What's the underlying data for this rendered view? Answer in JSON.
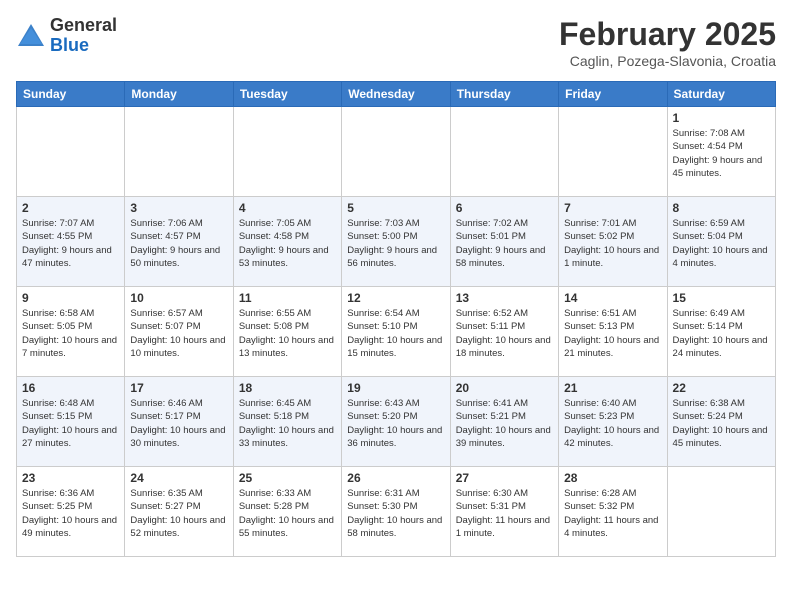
{
  "header": {
    "logo_general": "General",
    "logo_blue": "Blue",
    "title": "February 2025",
    "subtitle": "Caglin, Pozega-Slavonia, Croatia"
  },
  "days_of_week": [
    "Sunday",
    "Monday",
    "Tuesday",
    "Wednesday",
    "Thursday",
    "Friday",
    "Saturday"
  ],
  "weeks": [
    [
      {
        "day": "",
        "info": ""
      },
      {
        "day": "",
        "info": ""
      },
      {
        "day": "",
        "info": ""
      },
      {
        "day": "",
        "info": ""
      },
      {
        "day": "",
        "info": ""
      },
      {
        "day": "",
        "info": ""
      },
      {
        "day": "1",
        "info": "Sunrise: 7:08 AM\nSunset: 4:54 PM\nDaylight: 9 hours and 45 minutes."
      }
    ],
    [
      {
        "day": "2",
        "info": "Sunrise: 7:07 AM\nSunset: 4:55 PM\nDaylight: 9 hours and 47 minutes."
      },
      {
        "day": "3",
        "info": "Sunrise: 7:06 AM\nSunset: 4:57 PM\nDaylight: 9 hours and 50 minutes."
      },
      {
        "day": "4",
        "info": "Sunrise: 7:05 AM\nSunset: 4:58 PM\nDaylight: 9 hours and 53 minutes."
      },
      {
        "day": "5",
        "info": "Sunrise: 7:03 AM\nSunset: 5:00 PM\nDaylight: 9 hours and 56 minutes."
      },
      {
        "day": "6",
        "info": "Sunrise: 7:02 AM\nSunset: 5:01 PM\nDaylight: 9 hours and 58 minutes."
      },
      {
        "day": "7",
        "info": "Sunrise: 7:01 AM\nSunset: 5:02 PM\nDaylight: 10 hours and 1 minute."
      },
      {
        "day": "8",
        "info": "Sunrise: 6:59 AM\nSunset: 5:04 PM\nDaylight: 10 hours and 4 minutes."
      }
    ],
    [
      {
        "day": "9",
        "info": "Sunrise: 6:58 AM\nSunset: 5:05 PM\nDaylight: 10 hours and 7 minutes."
      },
      {
        "day": "10",
        "info": "Sunrise: 6:57 AM\nSunset: 5:07 PM\nDaylight: 10 hours and 10 minutes."
      },
      {
        "day": "11",
        "info": "Sunrise: 6:55 AM\nSunset: 5:08 PM\nDaylight: 10 hours and 13 minutes."
      },
      {
        "day": "12",
        "info": "Sunrise: 6:54 AM\nSunset: 5:10 PM\nDaylight: 10 hours and 15 minutes."
      },
      {
        "day": "13",
        "info": "Sunrise: 6:52 AM\nSunset: 5:11 PM\nDaylight: 10 hours and 18 minutes."
      },
      {
        "day": "14",
        "info": "Sunrise: 6:51 AM\nSunset: 5:13 PM\nDaylight: 10 hours and 21 minutes."
      },
      {
        "day": "15",
        "info": "Sunrise: 6:49 AM\nSunset: 5:14 PM\nDaylight: 10 hours and 24 minutes."
      }
    ],
    [
      {
        "day": "16",
        "info": "Sunrise: 6:48 AM\nSunset: 5:15 PM\nDaylight: 10 hours and 27 minutes."
      },
      {
        "day": "17",
        "info": "Sunrise: 6:46 AM\nSunset: 5:17 PM\nDaylight: 10 hours and 30 minutes."
      },
      {
        "day": "18",
        "info": "Sunrise: 6:45 AM\nSunset: 5:18 PM\nDaylight: 10 hours and 33 minutes."
      },
      {
        "day": "19",
        "info": "Sunrise: 6:43 AM\nSunset: 5:20 PM\nDaylight: 10 hours and 36 minutes."
      },
      {
        "day": "20",
        "info": "Sunrise: 6:41 AM\nSunset: 5:21 PM\nDaylight: 10 hours and 39 minutes."
      },
      {
        "day": "21",
        "info": "Sunrise: 6:40 AM\nSunset: 5:23 PM\nDaylight: 10 hours and 42 minutes."
      },
      {
        "day": "22",
        "info": "Sunrise: 6:38 AM\nSunset: 5:24 PM\nDaylight: 10 hours and 45 minutes."
      }
    ],
    [
      {
        "day": "23",
        "info": "Sunrise: 6:36 AM\nSunset: 5:25 PM\nDaylight: 10 hours and 49 minutes."
      },
      {
        "day": "24",
        "info": "Sunrise: 6:35 AM\nSunset: 5:27 PM\nDaylight: 10 hours and 52 minutes."
      },
      {
        "day": "25",
        "info": "Sunrise: 6:33 AM\nSunset: 5:28 PM\nDaylight: 10 hours and 55 minutes."
      },
      {
        "day": "26",
        "info": "Sunrise: 6:31 AM\nSunset: 5:30 PM\nDaylight: 10 hours and 58 minutes."
      },
      {
        "day": "27",
        "info": "Sunrise: 6:30 AM\nSunset: 5:31 PM\nDaylight: 11 hours and 1 minute."
      },
      {
        "day": "28",
        "info": "Sunrise: 6:28 AM\nSunset: 5:32 PM\nDaylight: 11 hours and 4 minutes."
      },
      {
        "day": "",
        "info": ""
      }
    ]
  ]
}
